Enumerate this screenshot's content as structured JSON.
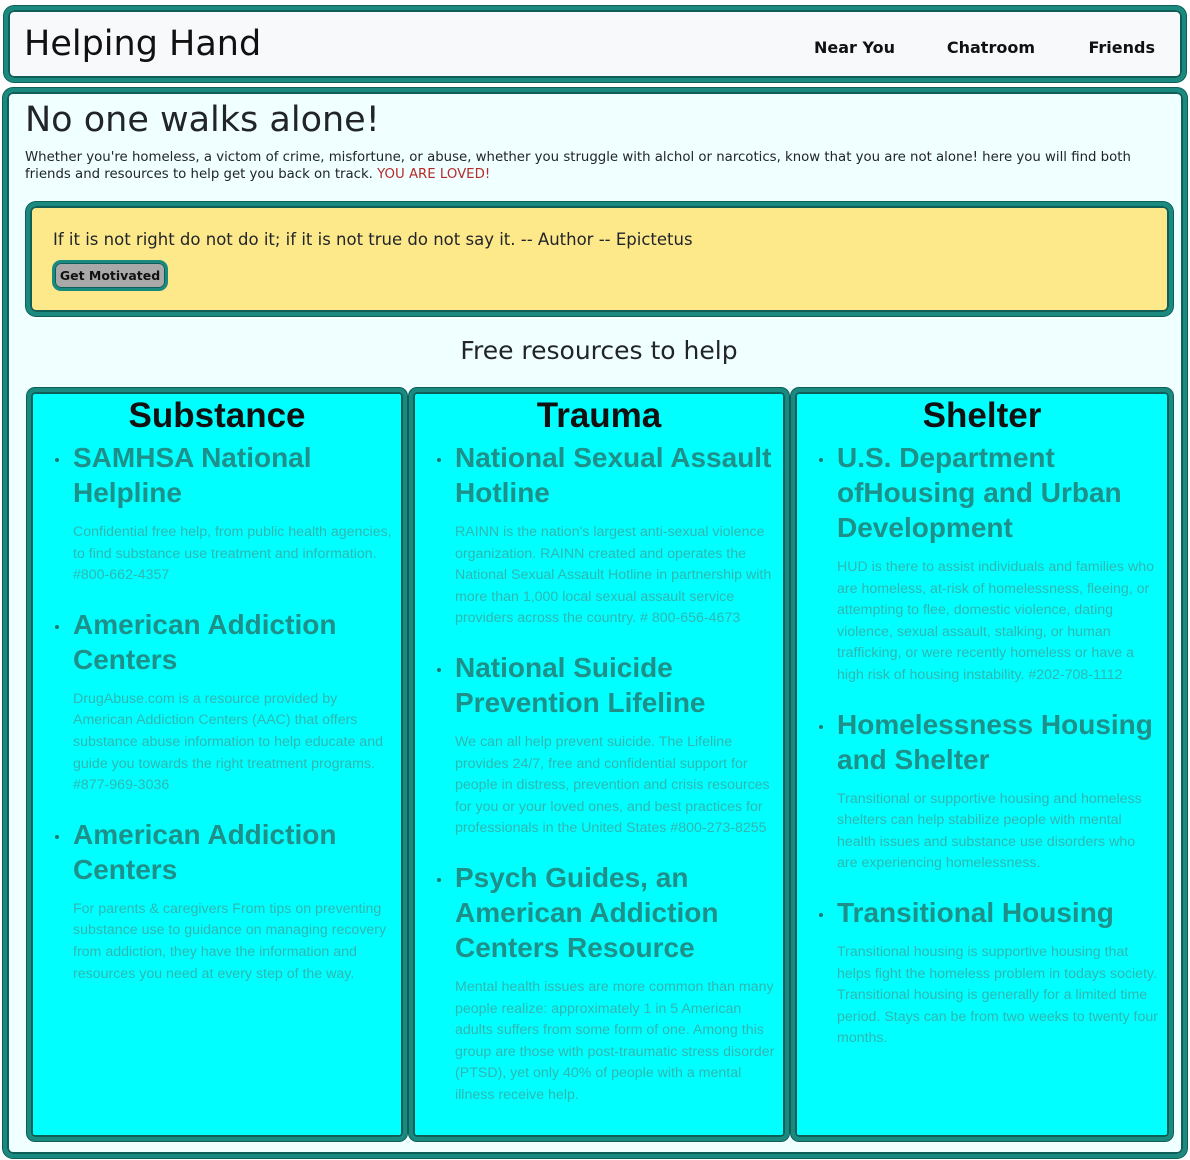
{
  "header": {
    "title": "Helping Hand",
    "nav": [
      {
        "label": "Near You"
      },
      {
        "label": "Chatroom"
      },
      {
        "label": "Friends"
      }
    ]
  },
  "main": {
    "headline": "No one walks alone!",
    "intro": "Whether you're homeless, a victom of crime, misfortune, or abuse, whether you struggle with alchol or narcotics, know that you are not alone! here you will find both friends and resources to help get you back on track.",
    "intro_loved": "YOU ARE LOVED!",
    "quote": {
      "text": "If it is not right do not do it; if it is not true do not say it. -- Author -- Epictetus",
      "button_label": "Get Motivated"
    },
    "resources_title": "Free resources to help",
    "columns": [
      {
        "title": "Substance",
        "items": [
          {
            "name": "SAMHSA National Helpline",
            "desc": "Confidential free help, from public health agencies, to find substance use treatment and information. #800-662-4357"
          },
          {
            "name": "American Addiction Centers",
            "desc": "DrugAbuse.com is a resource provided by American Addiction Centers (AAC) that offers substance abuse information to help educate and guide you towards the right treatment programs. #877-969-3036"
          },
          {
            "name": "American Addiction Centers",
            "desc": "For parents & caregivers From tips on preventing substance use to guidance on managing recovery from addiction, they have the information and resources you need at every step of the way."
          }
        ]
      },
      {
        "title": "Trauma",
        "items": [
          {
            "name": "National Sexual Assault Hotline",
            "desc": "RAINN is the nation's largest anti-sexual violence organization. RAINN created and operates the National Sexual Assault Hotline in partnership with more than 1,000 local sexual assault service providers across the country. # 800-656-4673"
          },
          {
            "name": "National Suicide Prevention Lifeline",
            "desc": "We can all help prevent suicide. The Lifeline provides 24/7, free and confidential support for people in distress, prevention and crisis resources for you or your loved ones, and best practices for professionals in the United States #800-273-8255"
          },
          {
            "name": "Psych Guides, an American Addiction Centers Resource",
            "desc": "Mental health issues are more common than many people realize: approximately 1 in 5 American adults suffers from some form of one. Among this group are those with post-traumatic stress disorder (PTSD), yet only 40% of people with a mental illness receive help."
          }
        ]
      },
      {
        "title": "Shelter",
        "items": [
          {
            "name": "U.S. Department ofHousing and Urban Development",
            "desc": "HUD is there to assist individuals and families who are homeless, at-risk of homelessness, fleeing, or attempting to flee, domestic violence, dating violence, sexual assault, stalking, or human trafficking, or were recently homeless or have a high risk of housing instability. #202-708-1112"
          },
          {
            "name": "Homelessness Housing and Shelter",
            "desc": "Transitional or supportive housing and homeless shelters can help stabilize people with mental health issues and substance use disorders who are experiencing homelessness."
          },
          {
            "name": "Transitional Housing",
            "desc": "Transitional housing is supportive housing that helps fight the homeless problem in todays society. Transitional housing is generally for a limited time period. Stays can be from two weeks to twenty four months."
          }
        ]
      }
    ]
  },
  "colors": {
    "accent_border": "#1a8a80",
    "page_bg": "#f0ffff",
    "card_bg": "#00ffff",
    "quote_bg": "#fde98a",
    "link": "#1f8f89",
    "loved": "#b52a2a"
  }
}
